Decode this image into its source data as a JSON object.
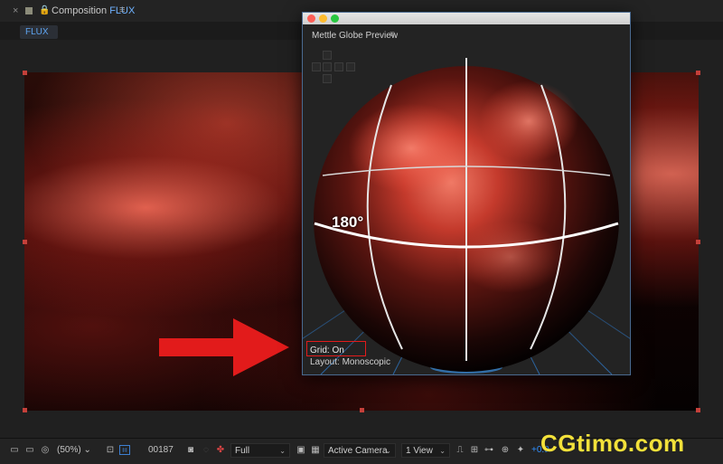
{
  "panel": {
    "close_glyph": "×",
    "lock_glyph": "🔒",
    "title_prefix": "Composition",
    "comp_name": "FLUX",
    "menu_glyph": "≡",
    "tab_label": "FLUX"
  },
  "globe_window": {
    "title": "Mettle Globe Preview",
    "menu_glyph": "≡",
    "degree_label": "180°",
    "grid_status": "Grid: On",
    "layout_status": "Layout: Monoscopic"
  },
  "toolbar": {
    "magnification": "(50%)",
    "magnification_chevron": "⌄",
    "timecode": "00187",
    "resolution": "Full",
    "camera": "Active Camera",
    "views": "1 View",
    "exposure": "+0.0",
    "chevron": "⌄"
  },
  "watermark": "CGtimo.com",
  "icons": {
    "close": "close-icon",
    "lock": "lock-icon",
    "menu": "hamburger-menu-icon",
    "snapshot": "camera-snapshot-icon",
    "color": "color-channel-icon"
  },
  "colors": {
    "accent": "#2f8fff",
    "arrow": "#e21b1b",
    "watermark": "#f3e13a"
  }
}
